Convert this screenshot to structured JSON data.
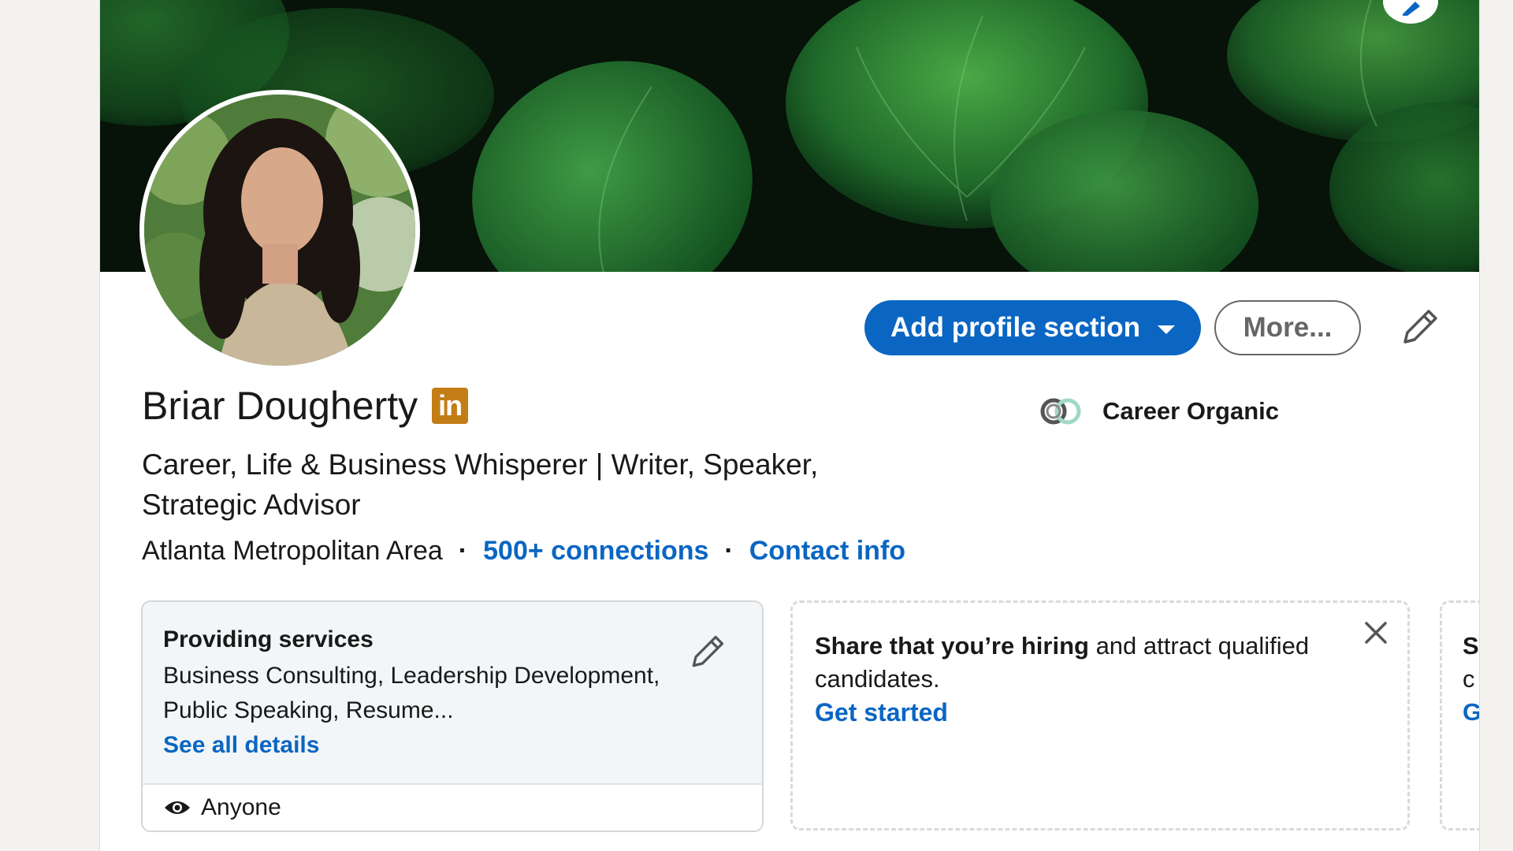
{
  "profile": {
    "name": "Briar Dougherty",
    "badge_text": "in",
    "headline": "Career, Life & Business Whisperer | Writer, Speaker, Strategic Advisor",
    "location": "Atlanta Metropolitan Area",
    "separator": "·",
    "connections": "500+ connections",
    "contact_info": "Contact info",
    "current_company": "Career Organic"
  },
  "actions": {
    "add_section": "Add profile section",
    "more": "More..."
  },
  "services_card": {
    "title": "Providing services",
    "services": "Business Consulting, Leadership Development, Public Speaking, Resume...",
    "see_all": "See all details",
    "visibility": "Anyone"
  },
  "hiring_card": {
    "bold": "Share that you’re hiring",
    "rest": " and attract qualified candidates.",
    "cta": "Get started"
  },
  "peek_card": {
    "line1": "S",
    "line2": "c",
    "line3": "G"
  },
  "colors": {
    "brand_blue": "#0a66c2",
    "badge_gold": "#c37d16",
    "page_bg": "#f3f2ef"
  },
  "icons": {
    "banner_edit": "pencil-icon",
    "profile_edit": "pencil-icon",
    "services_edit": "pencil-icon",
    "visibility": "eye-icon",
    "dismiss": "close-icon",
    "company_logo": "career-organic-logo"
  }
}
